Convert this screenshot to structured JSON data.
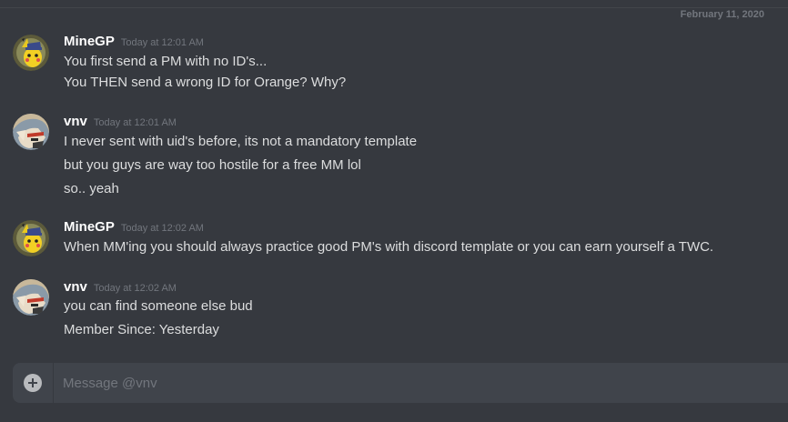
{
  "date_divider": "February 11, 2020",
  "messages": [
    {
      "username": "MineGP",
      "timestamp": "Today at 12:01 AM",
      "avatar": "pikachu-detective-avatar",
      "lines": [
        "You first send a PM with no ID's...",
        "You THEN send a wrong ID for Orange? Why?"
      ]
    },
    {
      "username": "vnv",
      "timestamp": "Today at 12:01 AM",
      "avatar": "anime-character-avatar",
      "lines": [
        "I never sent with uid's before, its not a mandatory template",
        "but you guys are way too hostile for a free MM lol",
        "so.. yeah"
      ]
    },
    {
      "username": "MineGP",
      "timestamp": "Today at 12:02 AM",
      "avatar": "pikachu-detective-avatar",
      "lines": [
        "When MM'ing you should always practice good PM's with discord template or you can earn yourself a TWC."
      ]
    },
    {
      "username": "vnv",
      "timestamp": "Today at 12:02 AM",
      "avatar": "anime-character-avatar",
      "lines": [
        "you can find someone else bud",
        "Member Since: Yesterday"
      ]
    }
  ],
  "composer": {
    "placeholder": "Message @vnv",
    "attach_icon": "plus-circle-icon"
  },
  "colors": {
    "background": "#36393f",
    "composer_background": "#40444b",
    "username": "#ffffff",
    "timestamp": "#72767d",
    "message_text": "#dcddde"
  }
}
